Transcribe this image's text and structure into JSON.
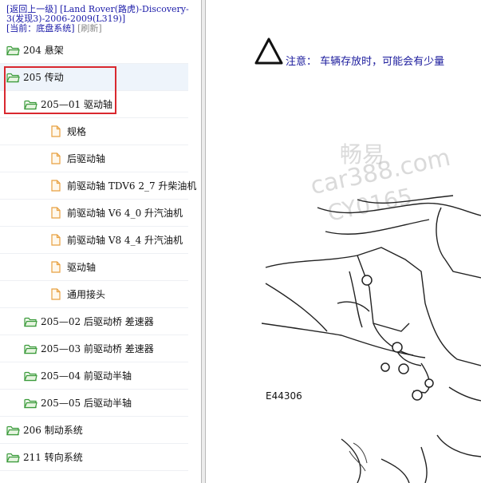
{
  "header": {
    "back_link": "[返回上一级]",
    "model_title": "[Land Rover(路虎)-Discovery-3(发现3)-2006-2009(L319)]",
    "current_prefix": "[当前：",
    "current_value": "底盘系统",
    "current_suffix": "]",
    "refresh": "[刷新]"
  },
  "tree": [
    {
      "label": "204 悬架",
      "kind": "folder",
      "level": 0
    },
    {
      "label": "205 传动",
      "kind": "folder",
      "level": 0,
      "selected": true
    },
    {
      "label": "205—01 驱动轴",
      "kind": "folder",
      "level": 1
    },
    {
      "label": "规格",
      "kind": "doc",
      "level": 2
    },
    {
      "label": "后驱动轴",
      "kind": "doc",
      "level": 2
    },
    {
      "label": "前驱动轴 TDV6 2_7 升柴油机",
      "kind": "doc",
      "level": 2
    },
    {
      "label": "前驱动轴 V6 4_0 升汽油机",
      "kind": "doc",
      "level": 2
    },
    {
      "label": "前驱动轴 V8 4_4 升汽油机",
      "kind": "doc",
      "level": 2
    },
    {
      "label": "驱动轴",
      "kind": "doc",
      "level": 2
    },
    {
      "label": "通用接头",
      "kind": "doc",
      "level": 2
    },
    {
      "label": "205—02 后驱动桥 差速器",
      "kind": "folder",
      "level": 1
    },
    {
      "label": "205—03 前驱动桥 差速器",
      "kind": "folder",
      "level": 1
    },
    {
      "label": "205—04 前驱动半轴",
      "kind": "folder",
      "level": 1
    },
    {
      "label": "205—05 后驱动半轴",
      "kind": "folder",
      "level": 1
    },
    {
      "label": "206 制动系统",
      "kind": "folder",
      "level": 0
    },
    {
      "label": "211 转向系统",
      "kind": "folder",
      "level": 0
    }
  ],
  "content": {
    "note_text": "注意：  车辆存放时，可能会有少量",
    "figure_code": "E44306",
    "watermark_1": "畅易",
    "watermark_2": "car388.com",
    "watermark_3": "CY0165"
  },
  "colors": {
    "link": "#1a1aa8",
    "highlight": "#d9282f",
    "folder": "#3a9a3a",
    "doc": "#e8a040"
  }
}
